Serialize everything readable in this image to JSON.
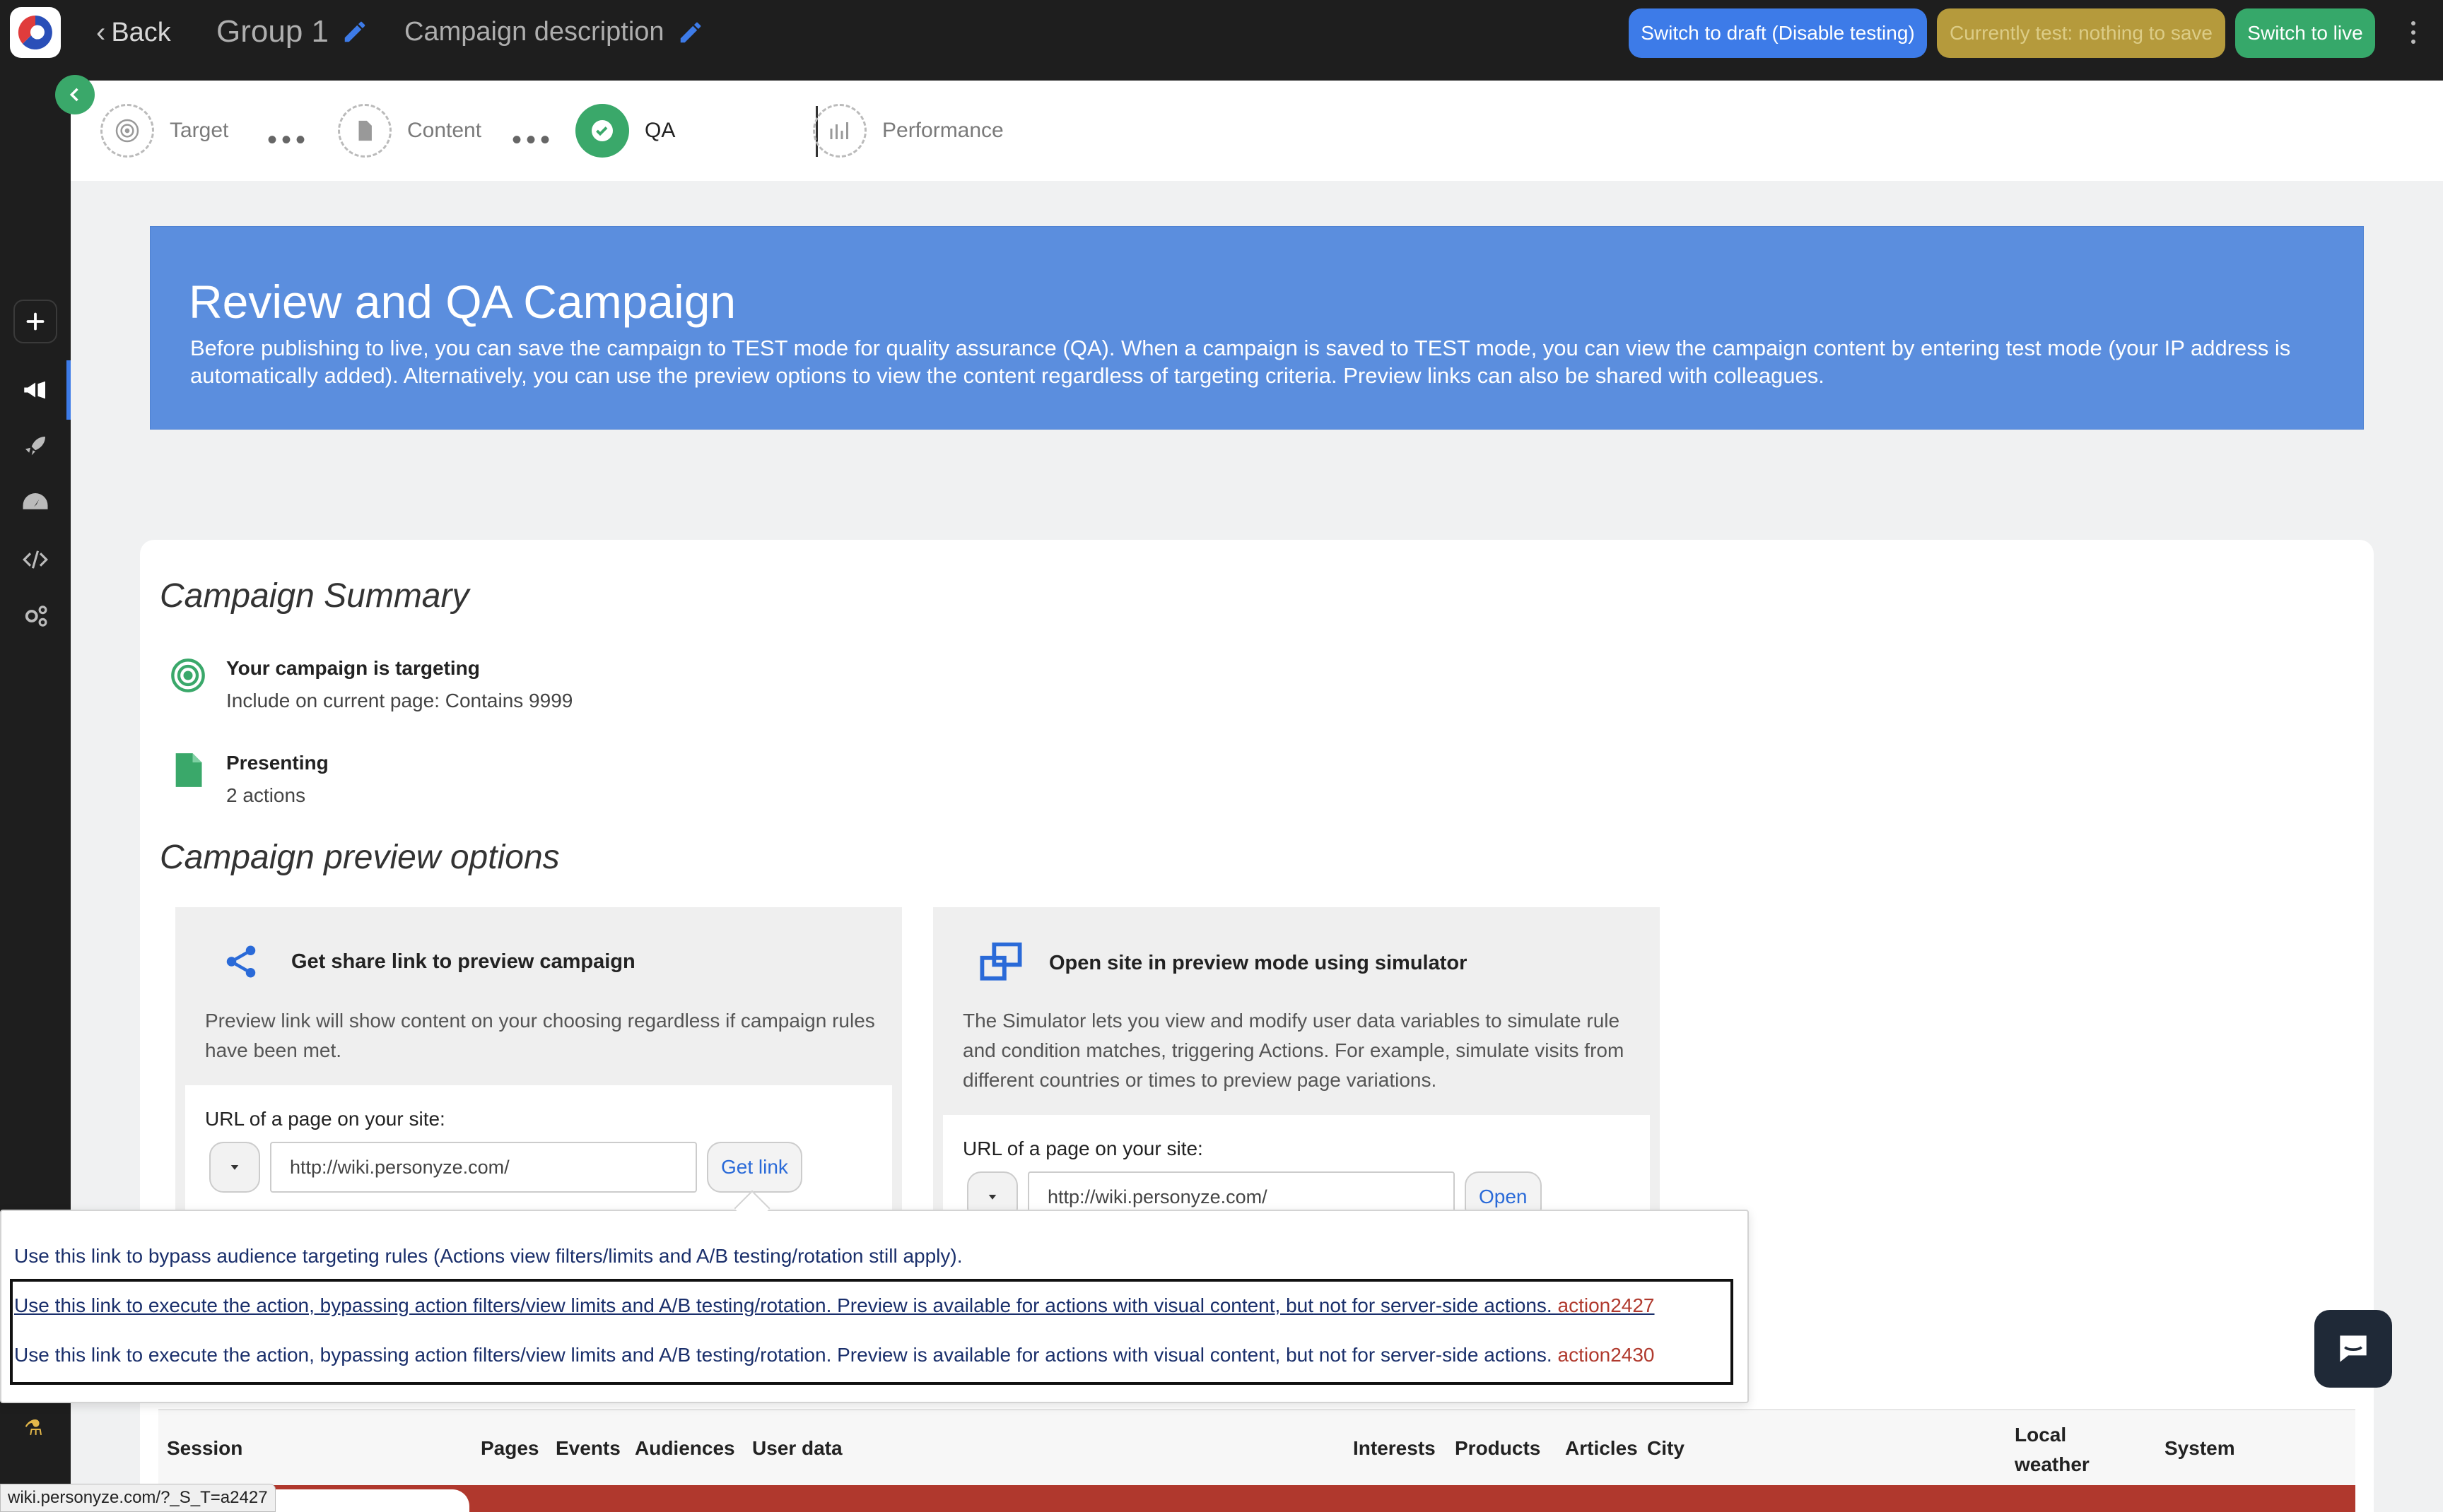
{
  "topbar": {
    "back_label": "Back",
    "group_title": "Group 1",
    "campaign_description": "Campaign description",
    "btn_draft": "Switch to draft (Disable testing)",
    "btn_test": "Currently test: nothing to save",
    "btn_live": "Switch to live"
  },
  "stepper": {
    "steps": [
      {
        "label": "Target",
        "icon": "target-icon",
        "state": "inactive"
      },
      {
        "label": "Content",
        "icon": "document-icon",
        "state": "inactive"
      },
      {
        "label": "QA",
        "icon": "check-icon",
        "state": "active"
      },
      {
        "label": "Performance",
        "icon": "bar-chart-icon",
        "state": "inactive"
      }
    ]
  },
  "hero": {
    "title": "Review and QA Campaign",
    "text": "Before publishing to live, you can save the campaign to TEST mode for quality assurance (QA). When a campaign is saved to TEST mode, you can view the campaign content by entering test mode (your IP address is automatically added). Alternatively, you can use the preview options to view the content regardless of targeting criteria. Preview links can also be shared with colleagues."
  },
  "summary": {
    "title": "Campaign Summary",
    "targeting_title": "Your campaign is targeting",
    "targeting_detail": "Include on current page: Contains 9999",
    "presenting_title": "Presenting",
    "presenting_detail": "2 actions"
  },
  "preview": {
    "title": "Campaign preview options",
    "share": {
      "title": "Get share link to preview campaign",
      "description": "Preview link will show content on your choosing regardless if campaign rules have been met.",
      "url_label": "URL of a page on your site:",
      "url_value": "http://wiki.personyze.com/",
      "button": "Get link"
    },
    "simulator": {
      "title": "Open site in preview mode using simulator",
      "description": "The Simulator lets you view and modify user data variables to simulate rule and condition matches, triggering Actions. For example, simulate visits from different countries or times to preview page variations.",
      "url_label": "URL of a page on your site:",
      "url_value": "http://wiki.personyze.com/",
      "button": "Open"
    }
  },
  "popover": {
    "line1": "Use this link to bypass audience targeting rules (Actions view filters/limits and A/B testing/rotation still apply).",
    "line2": "Use this link to execute the action, bypassing action filters/view limits and A/B testing/rotation. Preview is available for actions with visual content, but not for server-side actions. ",
    "line2_action": "action2427",
    "line3": "Use this link to execute the action, bypassing action filters/view limits and A/B testing/rotation. Preview is available for actions with visual content, but not for server-side actions. ",
    "line3_action": "action2430"
  },
  "table": {
    "columns": [
      "Session",
      "Pages",
      "Events",
      "Audiences",
      "User data",
      "Interests",
      "Products",
      "Articles",
      "City",
      "Local weather",
      "System"
    ]
  },
  "status_bar": {
    "url": "wiki.personyze.com/?_S_T=a2427"
  },
  "colors": {
    "hero_bg": "#5b8ede",
    "accent_green": "#3aa86a",
    "accent_blue": "#3d7be8",
    "test_mode": "#b59a3c",
    "row_red": "#b0382d"
  }
}
